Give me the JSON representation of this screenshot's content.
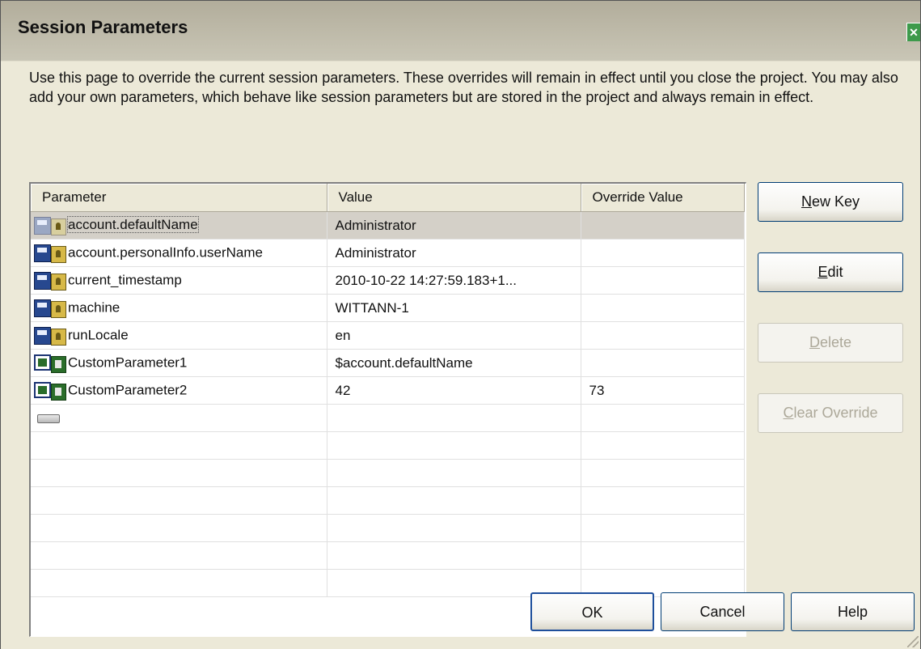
{
  "window": {
    "title": "Session Parameters",
    "close_glyph": "✕"
  },
  "description": "Use this page to override the current session parameters. These overrides will remain in effect until you close the project. You may also add your own parameters, which behave like session parameters but are stored in the project and always remain in effect.",
  "table": {
    "headers": [
      "Parameter",
      "Value",
      "Override Value"
    ],
    "rows": [
      {
        "parameter": "account.defaultName",
        "value": "Administrator",
        "override": "",
        "icon": "session-parameter-icon"
      },
      {
        "parameter": "account.personalInfo.userName",
        "value": "Administrator",
        "override": "",
        "icon": "session-parameter-icon"
      },
      {
        "parameter": "current_timestamp",
        "value": "2010-10-22 14:27:59.183+1...",
        "override": "",
        "icon": "session-parameter-icon"
      },
      {
        "parameter": "machine",
        "value": "WITTANN-1",
        "override": "",
        "icon": "session-parameter-icon"
      },
      {
        "parameter": "runLocale",
        "value": "en",
        "override": "",
        "icon": "session-parameter-icon"
      },
      {
        "parameter": "CustomParameter1",
        "value": "$account.defaultName",
        "override": "",
        "icon": "custom-parameter-icon"
      },
      {
        "parameter": "CustomParameter2",
        "value": "42",
        "override": "73",
        "icon": "custom-parameter-icon"
      }
    ]
  },
  "buttons": {
    "new_key": {
      "label": "New Key",
      "mnemonic": "N"
    },
    "edit": {
      "label": "Edit",
      "mnemonic": "E"
    },
    "delete": {
      "label": "Delete",
      "mnemonic": "D"
    },
    "clear_override": {
      "label": "Clear Override",
      "mnemonic": "C"
    },
    "ok": "OK",
    "cancel": "Cancel",
    "help": "Help"
  }
}
